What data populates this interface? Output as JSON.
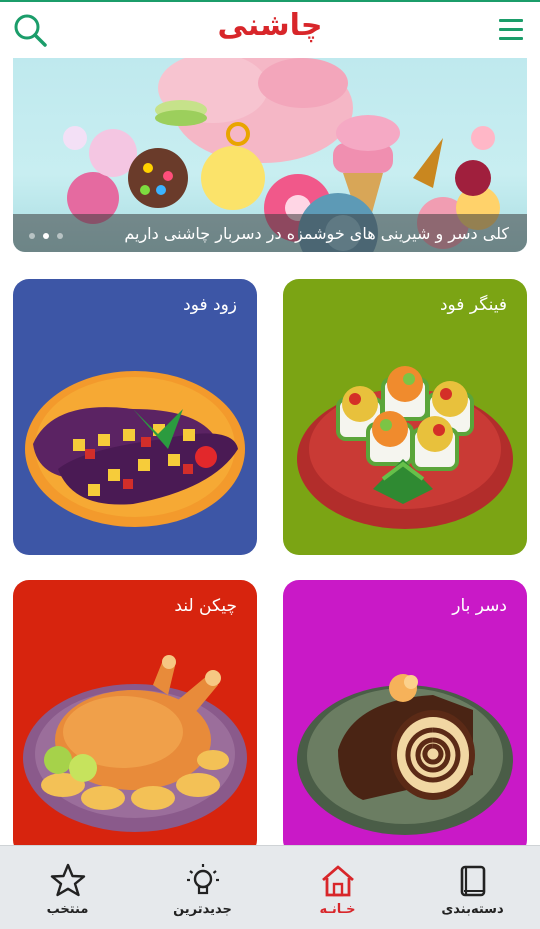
{
  "app": {
    "title": "چاشنی",
    "accent_color": "#d8262a",
    "header_icon_color": "#1b9d6a"
  },
  "header": {
    "search_icon": "search-icon",
    "menu_icon": "hamburger-menu-icon"
  },
  "banner": {
    "caption": "کلی دسر و شیرینی های خوشمزه در دسربار چاشنی داریم",
    "dots_total": 3,
    "active_dot": 2
  },
  "categories": [
    {
      "label": "فینگر فود",
      "color": "#7ba414",
      "icon": "finger-food-icon"
    },
    {
      "label": "زود فود",
      "color": "#3d56a6",
      "icon": "stuffed-eggplant-icon"
    },
    {
      "label": "دسر بار",
      "color": "#c919c7",
      "icon": "roll-cake-icon"
    },
    {
      "label": "چیکن لند",
      "color": "#d7240e",
      "icon": "roast-chicken-icon"
    }
  ],
  "bottom_nav": {
    "items": [
      {
        "label": "دسته‌بندی",
        "icon": "book-icon"
      },
      {
        "label": "خـانـه",
        "icon": "home-icon",
        "active": true
      },
      {
        "label": "جدیدترین",
        "icon": "lightbulb-icon"
      },
      {
        "label": "منتخب",
        "icon": "star-icon"
      }
    ]
  }
}
